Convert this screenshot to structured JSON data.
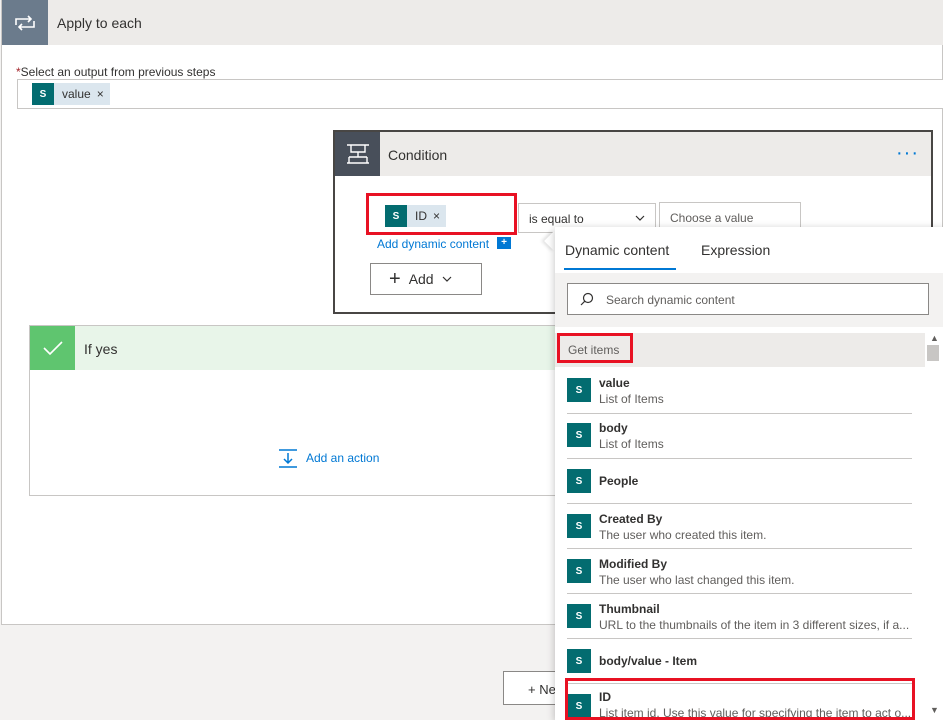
{
  "apply": {
    "title": "Apply to each",
    "output_label": "Select an output from previous steps",
    "required_mark": "*",
    "token_label": "value",
    "token_close": "×",
    "sp_glyph": "S"
  },
  "condition": {
    "title": "Condition",
    "more": "···",
    "token_label": "ID",
    "token_close": "×",
    "operator": "is equal to",
    "value_placeholder": "Choose a value",
    "add_dynamic": "Add dynamic content",
    "add_dynamic_plus": "+",
    "add_label": "Add"
  },
  "if_yes": {
    "title": "If yes",
    "add_action": "Add an action"
  },
  "new_step": {
    "label": "+ New step"
  },
  "dynamic": {
    "tabs": [
      "Dynamic content",
      "Expression"
    ],
    "search_placeholder": "Search dynamic content",
    "group": "Get items",
    "items": [
      {
        "name": "value",
        "desc": "List of Items"
      },
      {
        "name": "body",
        "desc": "List of Items"
      },
      {
        "name": "People",
        "desc": ""
      },
      {
        "name": "Created By",
        "desc": "The user who created this item."
      },
      {
        "name": "Modified By",
        "desc": "The user who last changed this item."
      },
      {
        "name": "Thumbnail",
        "desc": "URL to the thumbnails of the item in 3 different sizes, if a..."
      },
      {
        "name": "body/value - Item",
        "desc": ""
      },
      {
        "name": "ID",
        "desc": "List item id. Use this value for specifying the item to act o..."
      }
    ]
  },
  "colors": {
    "accent": "#0078d4",
    "highlight": "#e81123",
    "sharepoint": "#036c70"
  }
}
